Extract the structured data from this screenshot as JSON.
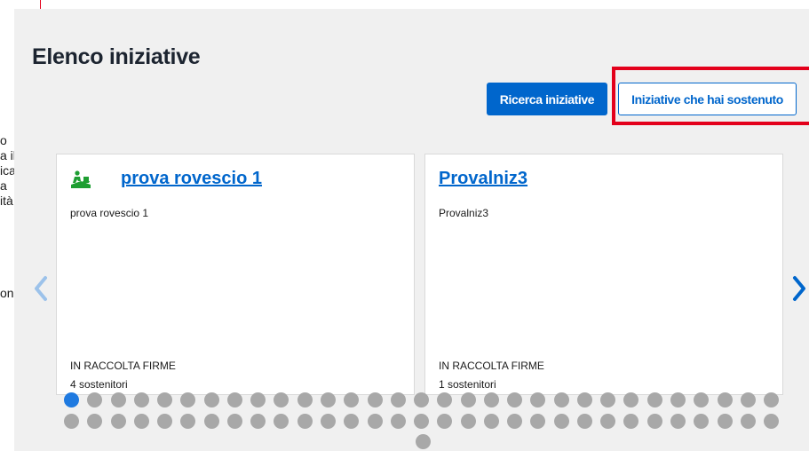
{
  "page": {
    "title": "Elenco iniziative"
  },
  "left_clip": {
    "lines": [
      "o",
      "a il",
      "ica",
      "a",
      "ità",
      "on"
    ]
  },
  "actions": {
    "search_label": "Ricerca iniziative",
    "supported_label": "Iniziative che hai sostenuto"
  },
  "colors": {
    "primary": "#0066cc",
    "highlight": "#e3001b",
    "icon_green": "#1e9e32",
    "dot_active": "#1f7ae0",
    "dot_inactive": "#a8a8a8"
  },
  "carousel": {
    "prev_icon": "chevron-left-icon",
    "next_icon": "chevron-right-icon",
    "cards": [
      {
        "icon": "people-signing-icon",
        "title": "prova rovescio 1",
        "description": "prova rovescio 1",
        "status": "IN RACCOLTA FIRME",
        "supporters": "4 sostenitori"
      },
      {
        "title": "Provalniz3",
        "description": "Provalniz3",
        "status": "IN RACCOLTA FIRME",
        "supporters": "1 sostenitori"
      }
    ],
    "pagination": {
      "total": 63,
      "active_index": 0
    }
  }
}
